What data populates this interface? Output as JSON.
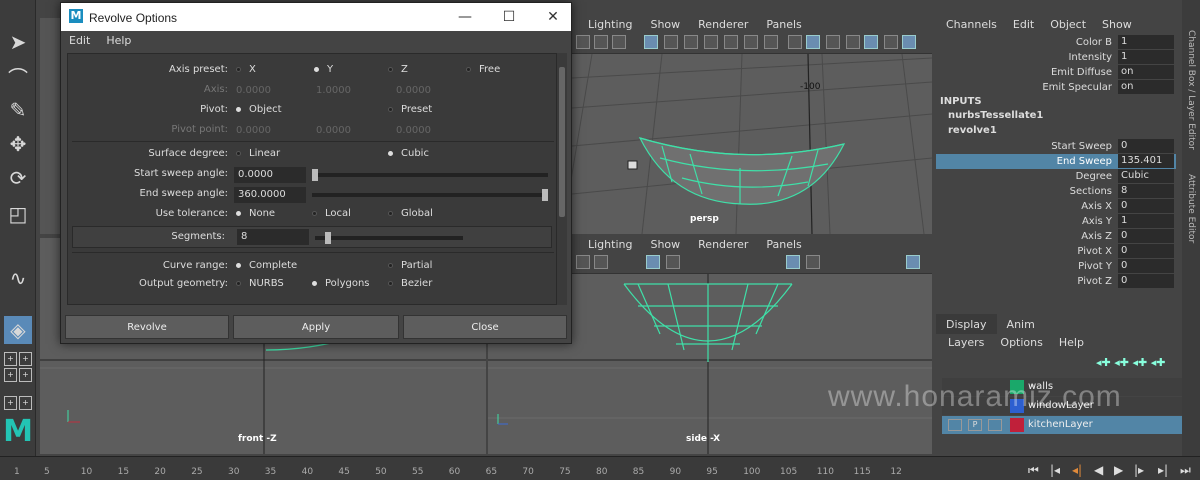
{
  "dialog": {
    "title": "Revolve Options",
    "menu": [
      "Edit",
      "Help"
    ],
    "axis_preset_label": "Axis preset:",
    "axis_preset_options": [
      "X",
      "Y",
      "Z",
      "Free"
    ],
    "axis_preset_selected": "Y",
    "axis_label": "Axis:",
    "axis_values": [
      "0.0000",
      "1.0000",
      "0.0000"
    ],
    "pivot_label": "Pivot:",
    "pivot_options": [
      "Object",
      "Preset"
    ],
    "pivot_selected": "Object",
    "pivot_point_label": "Pivot point:",
    "pivot_point_values": [
      "0.0000",
      "0.0000",
      "0.0000"
    ],
    "surface_degree_label": "Surface degree:",
    "surface_degree_options": [
      "Linear",
      "Cubic"
    ],
    "surface_degree_selected": "Cubic",
    "start_sweep_label": "Start sweep angle:",
    "start_sweep_value": "0.0000",
    "end_sweep_label": "End sweep angle:",
    "end_sweep_value": "360.0000",
    "use_tolerance_label": "Use tolerance:",
    "use_tolerance_options": [
      "None",
      "Local",
      "Global"
    ],
    "use_tolerance_selected": "None",
    "segments_label": "Segments:",
    "segments_value": "8",
    "curve_range_label": "Curve range:",
    "curve_range_options": [
      "Complete",
      "Partial"
    ],
    "curve_range_selected": "Complete",
    "output_geometry_label": "Output geometry:",
    "output_geometry_options": [
      "NURBS",
      "Polygons",
      "Bezier"
    ],
    "output_geometry_selected": "Polygons",
    "buttons": {
      "revolve": "Revolve",
      "apply": "Apply",
      "close": "Close"
    }
  },
  "viewports": {
    "menu": [
      "Lighting",
      "Show",
      "Renderer",
      "Panels"
    ],
    "persp_label": "persp",
    "persp_grid_label": "-100",
    "front_label": "front -Z",
    "side_label": "side -X"
  },
  "channel_box": {
    "menu": [
      "Channels",
      "Edit",
      "Object",
      "Show"
    ],
    "top_rows": [
      {
        "k": "Color B",
        "v": "1"
      },
      {
        "k": "Intensity",
        "v": "1"
      },
      {
        "k": "Emit Diffuse",
        "v": "on"
      },
      {
        "k": "Emit Specular",
        "v": "on"
      }
    ],
    "inputs_header": "INPUTS",
    "node1": "nurbsTessellate1",
    "node2": "revolve1",
    "rows": [
      {
        "k": "Start Sweep",
        "v": "0"
      },
      {
        "k": "End Sweep",
        "v": "135.401"
      },
      {
        "k": "Degree",
        "v": "Cubic"
      },
      {
        "k": "Sections",
        "v": "8"
      },
      {
        "k": "Axis X",
        "v": "0"
      },
      {
        "k": "Axis Y",
        "v": "1"
      },
      {
        "k": "Axis Z",
        "v": "0"
      },
      {
        "k": "Pivot X",
        "v": "0"
      },
      {
        "k": "Pivot Y",
        "v": "0"
      },
      {
        "k": "Pivot Z",
        "v": "0"
      }
    ],
    "selected_row": "End Sweep",
    "side_tab1": "Channel Box / Layer Editor",
    "side_tab2": "Attribute Editor"
  },
  "layers": {
    "tabs": [
      "Display",
      "Anim"
    ],
    "menu": [
      "Layers",
      "Options",
      "Help"
    ],
    "items": [
      {
        "name": "walls",
        "color": "#1aa86a"
      },
      {
        "name": "windowLayer",
        "color": "#2d5fd0"
      },
      {
        "name": "kitchenLayer",
        "color": "#c0203a"
      }
    ],
    "selected": "kitchenLayer"
  },
  "timeline": {
    "ticks": [
      "1",
      "5",
      "10",
      "15",
      "20",
      "25",
      "30",
      "35",
      "40",
      "45",
      "50",
      "55",
      "60",
      "65",
      "70",
      "75",
      "80",
      "85",
      "90",
      "95",
      "100",
      "105",
      "110",
      "115",
      "12"
    ]
  },
  "toolbox": {
    "mini1": [
      "+",
      "+"
    ],
    "mini2": [
      "+",
      "+"
    ],
    "mini3": [
      "+",
      "+"
    ]
  },
  "watermark": "www.honaramiz.com",
  "colors": {
    "accent": "#5285a6",
    "mesh": "#3fe0a8"
  }
}
